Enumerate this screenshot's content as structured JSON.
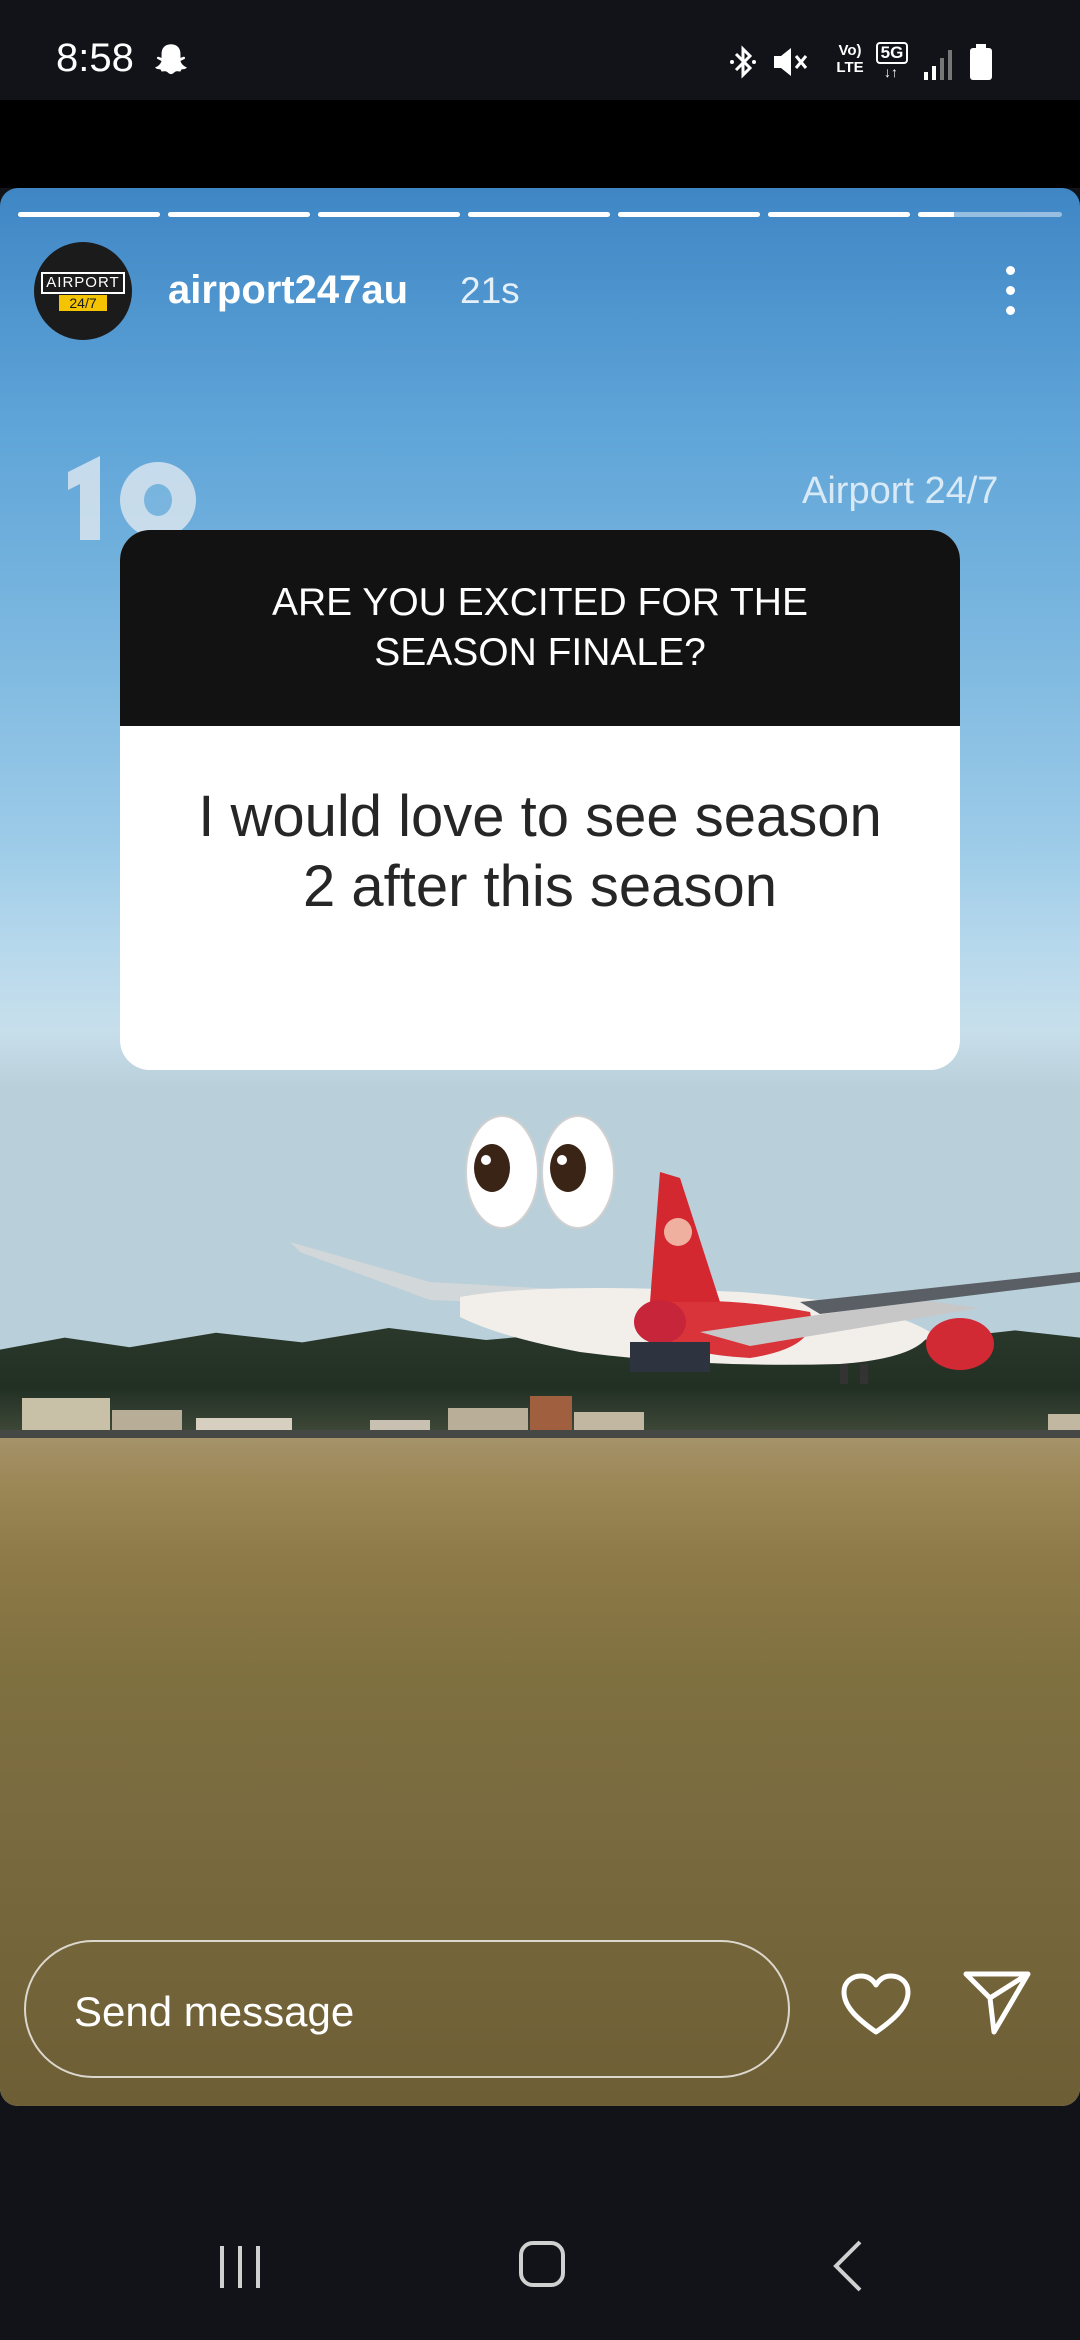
{
  "status_bar": {
    "time": "8:58",
    "icons": [
      "snapchat-icon",
      "bluetooth-icon",
      "mute-icon",
      "volte-icon",
      "5g-icon",
      "signal-icon",
      "battery-icon"
    ],
    "volte_top": "Vo)",
    "volte_bottom": "LTE",
    "network": "5G"
  },
  "story": {
    "segments_total": 7,
    "segments_complete": 6,
    "current_segment_progress": 0.25,
    "avatar": {
      "line1": "AIRPORT",
      "line2": "24/7"
    },
    "username": "airport247au",
    "time_ago": "21s",
    "watermark_text": "Airport 24/7",
    "question": "ARE YOU EXCITED FOR THE SEASON FINALE?",
    "answer": "I would love to see season 2 after this season",
    "sticker": "eyes-emoji"
  },
  "reply_bar": {
    "placeholder": "Send message"
  },
  "colors": {
    "question_header_bg": "#121212",
    "answer_text": "#262626",
    "system_bar_bg": "#111318"
  }
}
